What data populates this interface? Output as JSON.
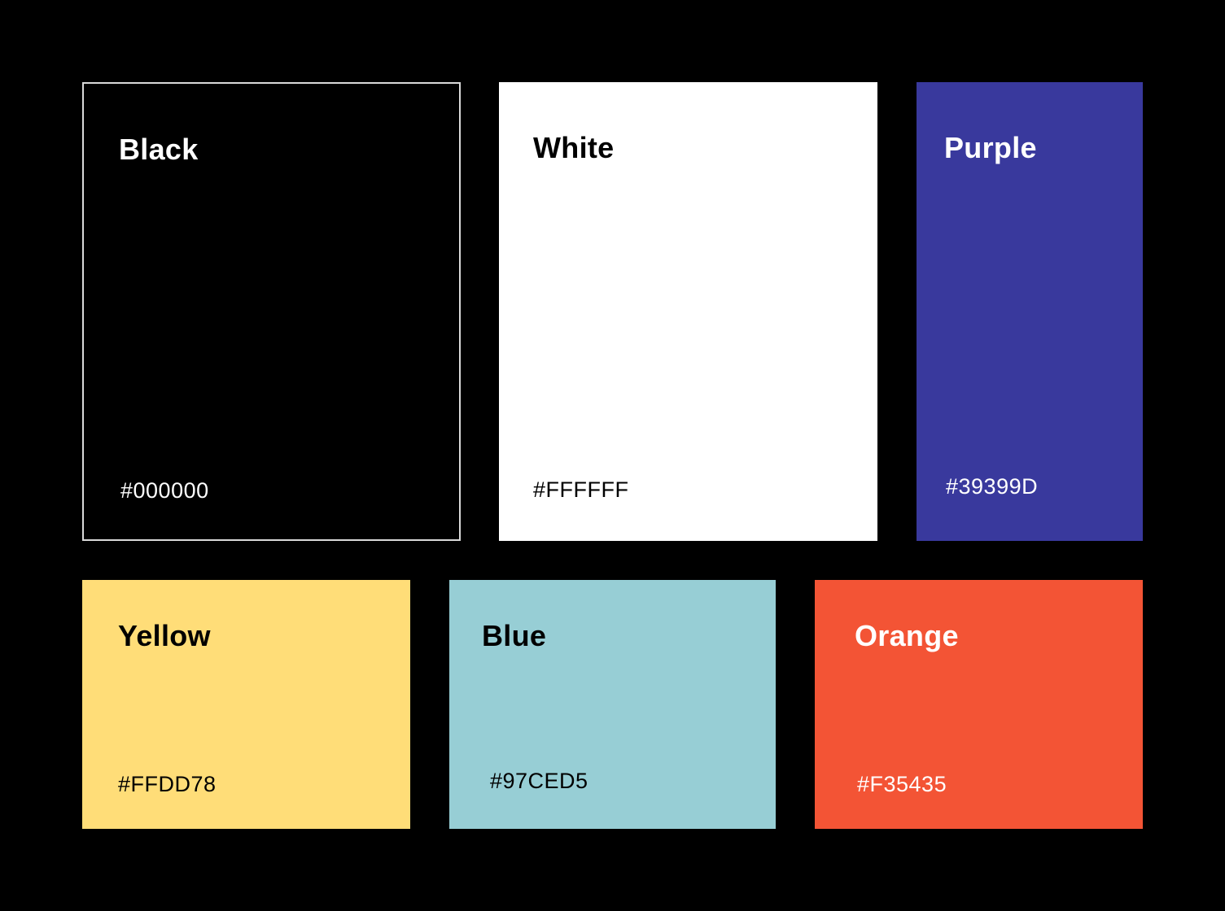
{
  "swatches": [
    {
      "name": "Black",
      "hex": "#000000",
      "color": "#000000",
      "text_color": "#FFFFFF"
    },
    {
      "name": "White",
      "hex": "#FFFFFF",
      "color": "#FFFFFF",
      "text_color": "#000000"
    },
    {
      "name": "Purple",
      "hex": "#39399D",
      "color": "#39399D",
      "text_color": "#FFFFFF"
    },
    {
      "name": "Yellow",
      "hex": "#FFDD78",
      "color": "#FFDD78",
      "text_color": "#000000"
    },
    {
      "name": "Blue",
      "hex": "#97CED5",
      "color": "#97CED5",
      "text_color": "#000000"
    },
    {
      "name": "Orange",
      "hex": "#F35435",
      "color": "#F35435",
      "text_color": "#FFFFFF"
    }
  ]
}
